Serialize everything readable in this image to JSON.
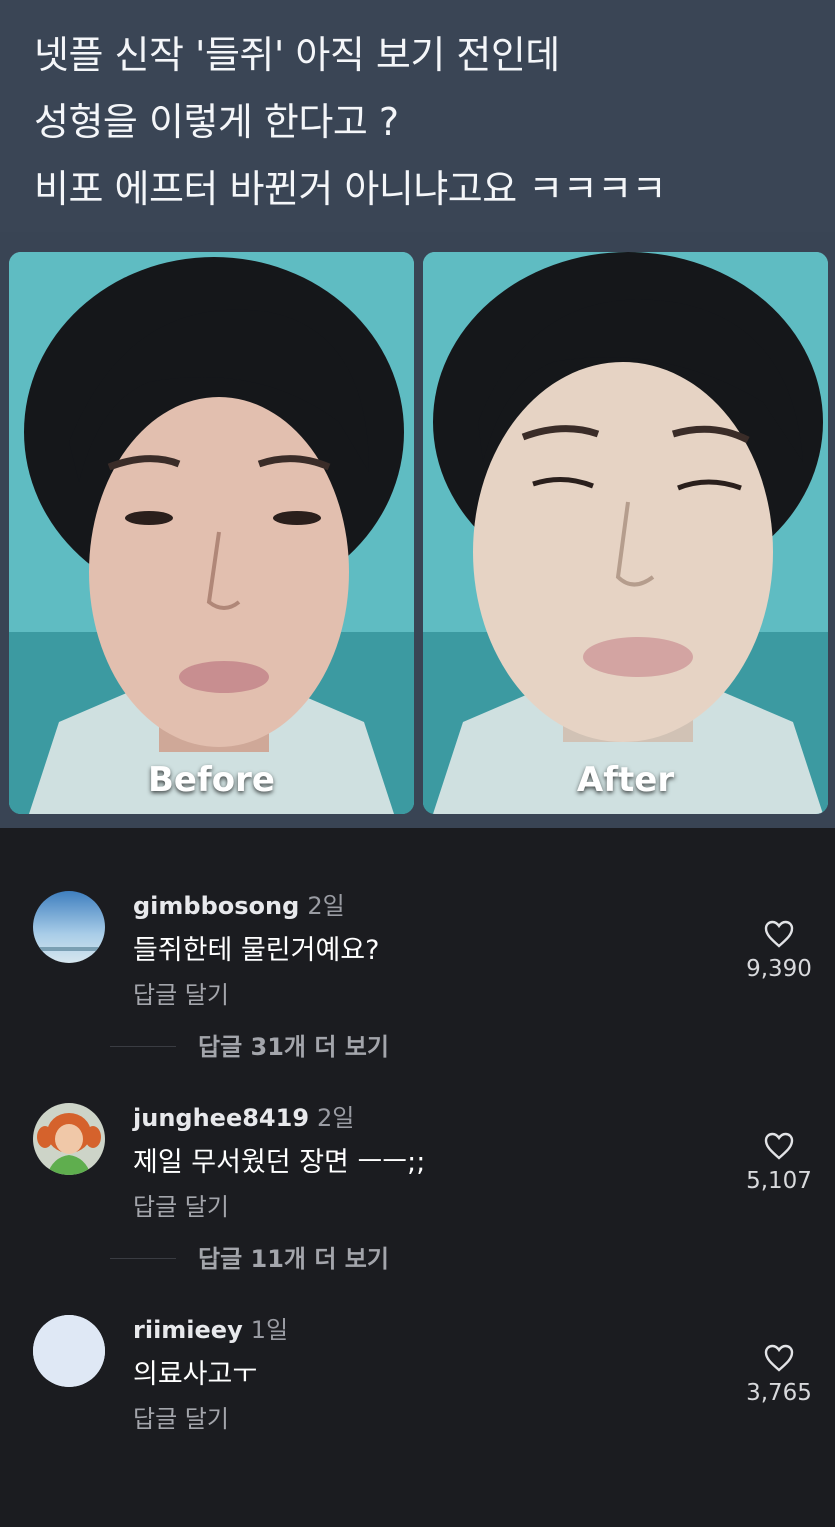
{
  "post": {
    "lines": [
      "넷플 신작 '들쥐' 아직 보기 전인데",
      "성형을 이렇게 한다고 ?",
      "비포 에프터 바뀐거 아니냐고요 ㅋㅋㅋㅋ"
    ],
    "image_labels": {
      "before": "Before",
      "after": "After"
    }
  },
  "comments": [
    {
      "username": "gimbbosong",
      "time": "2일",
      "text": "들쥐한테 물린거예요?",
      "reply_label": "답글 달기",
      "likes": "9,390",
      "view_replies": "답글 31개 더 보기",
      "avatar": "sky-photo"
    },
    {
      "username": "junghee8419",
      "time": "2일",
      "text": "제일 무서웠던 장면 ㅡㅡ;;",
      "reply_label": "답글 달기",
      "likes": "5,107",
      "view_replies": "답글 11개 더 보기",
      "avatar": "girl-photo"
    },
    {
      "username": "riimieey",
      "time": "1일",
      "text": "의료사고ㅜ",
      "reply_label": "답글 달기",
      "likes": "3,765",
      "avatar": "blank-light-blue"
    }
  ],
  "icons": {
    "like": "heart-icon"
  },
  "colors": {
    "header_bg": "#3a4555",
    "comments_bg": "#1b1c20",
    "teal_photo": "#3fa6ad"
  }
}
